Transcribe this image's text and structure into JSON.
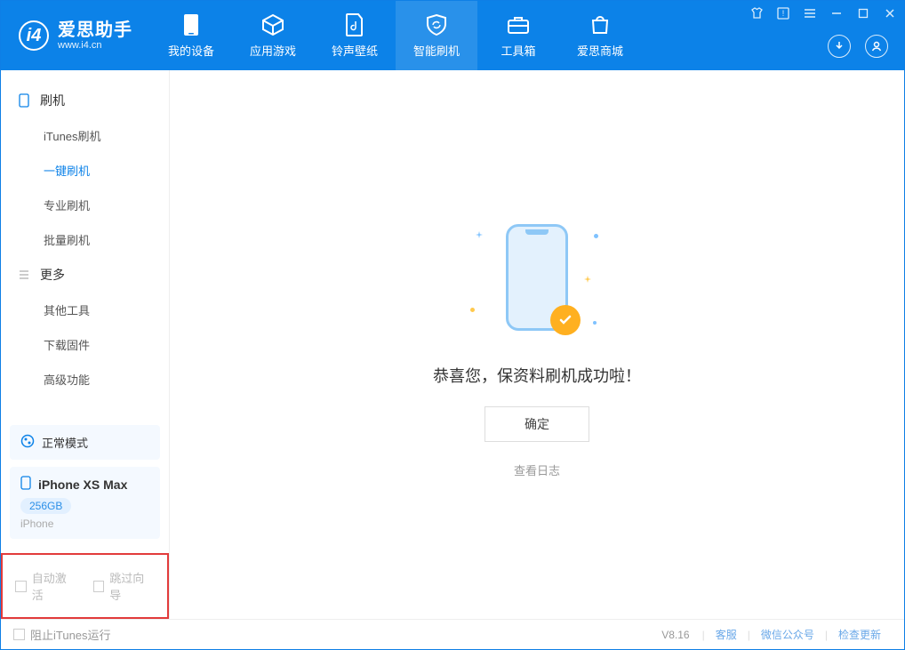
{
  "app": {
    "title": "爱思助手",
    "subtitle": "www.i4.cn"
  },
  "tabs": [
    {
      "id": "device",
      "label": "我的设备"
    },
    {
      "id": "apps",
      "label": "应用游戏"
    },
    {
      "id": "rings",
      "label": "铃声壁纸"
    },
    {
      "id": "flash",
      "label": "智能刷机"
    },
    {
      "id": "tools",
      "label": "工具箱"
    },
    {
      "id": "store",
      "label": "爱思商城"
    }
  ],
  "sidebar": {
    "sections": [
      {
        "id": "flash",
        "label": "刷机",
        "items": [
          {
            "id": "itunes",
            "label": "iTunes刷机"
          },
          {
            "id": "onekey",
            "label": "一键刷机",
            "active": true
          },
          {
            "id": "pro",
            "label": "专业刷机"
          },
          {
            "id": "batch",
            "label": "批量刷机"
          }
        ]
      },
      {
        "id": "more",
        "label": "更多",
        "items": [
          {
            "id": "other",
            "label": "其他工具"
          },
          {
            "id": "firmware",
            "label": "下载固件"
          },
          {
            "id": "advanced",
            "label": "高级功能"
          }
        ]
      }
    ],
    "mode_label": "正常模式",
    "device": {
      "name": "iPhone XS Max",
      "capacity": "256GB",
      "type": "iPhone"
    },
    "options": {
      "auto_activate": "自动激活",
      "skip_guide": "跳过向导"
    }
  },
  "main": {
    "success_text": "恭喜您，保资料刷机成功啦！",
    "ok_label": "确定",
    "log_link": "查看日志"
  },
  "footer": {
    "block_itunes": "阻止iTunes运行",
    "version": "V8.16",
    "links": {
      "service": "客服",
      "wechat": "微信公众号",
      "update": "检查更新"
    }
  }
}
